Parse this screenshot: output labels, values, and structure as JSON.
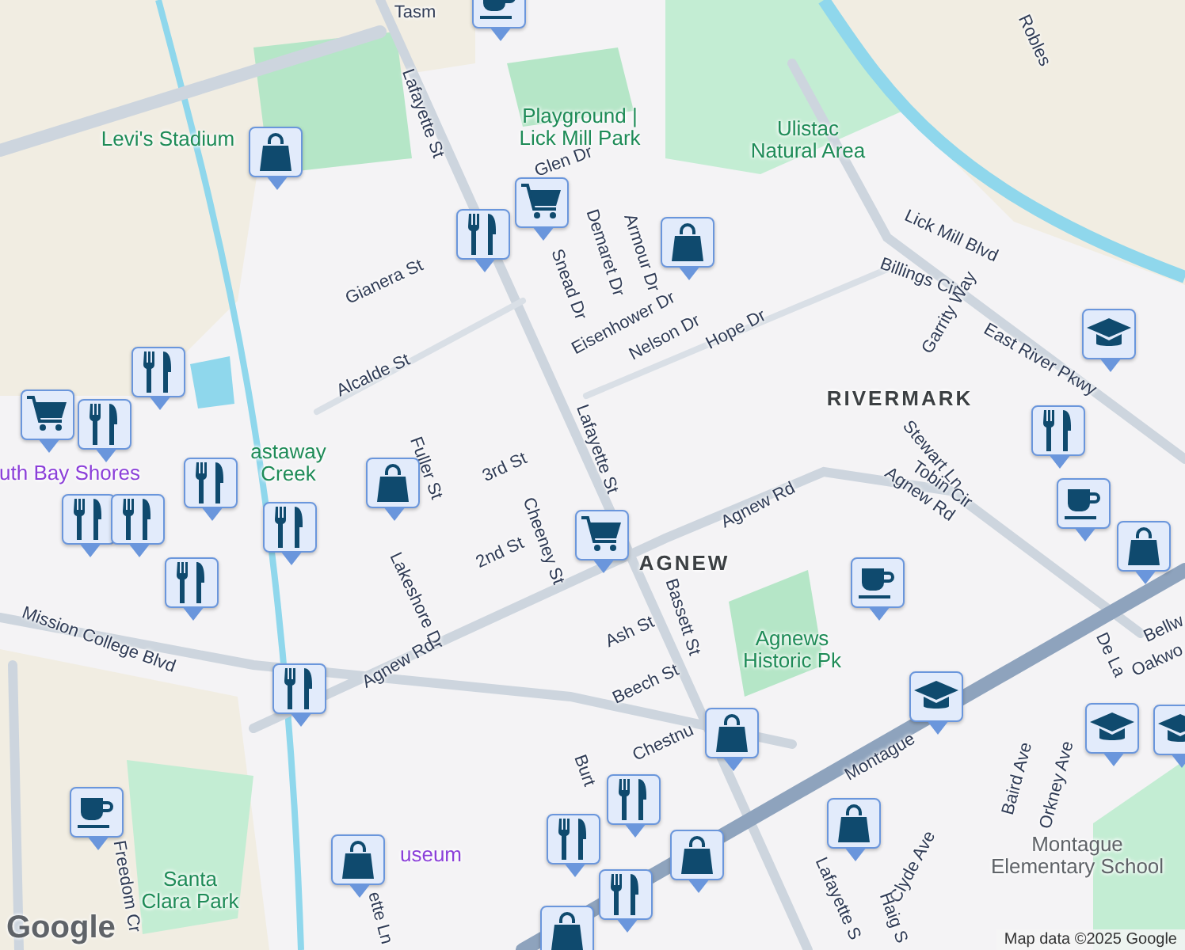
{
  "map": {
    "labels": [
      {
        "text": "Tasm",
        "kind": "street"
      },
      {
        "text": "Lafayette St",
        "kind": "street"
      },
      {
        "text": "Levi's Stadium",
        "kind": "park"
      },
      {
        "text": "Playground |\nLick Mill Park",
        "kind": "park"
      },
      {
        "text": "Ulistac\nNatural Area",
        "kind": "park"
      },
      {
        "text": "Robles",
        "kind": "street"
      },
      {
        "text": "Glen Dr",
        "kind": "street"
      },
      {
        "text": "Snead Dr",
        "kind": "street"
      },
      {
        "text": "Demaret Dr",
        "kind": "street"
      },
      {
        "text": "Armour Dr",
        "kind": "street"
      },
      {
        "text": "Eisenhower Dr",
        "kind": "street"
      },
      {
        "text": "Nelson Dr",
        "kind": "street"
      },
      {
        "text": "Hope Dr",
        "kind": "street"
      },
      {
        "text": "Lick Mill Blvd",
        "kind": "street"
      },
      {
        "text": "Billings Cir",
        "kind": "street"
      },
      {
        "text": "Garrity Way",
        "kind": "street"
      },
      {
        "text": "East River Pkwy",
        "kind": "street"
      },
      {
        "text": "RIVERMARK",
        "kind": "district"
      },
      {
        "text": "Gianera St",
        "kind": "street"
      },
      {
        "text": "Alcalde St",
        "kind": "street"
      },
      {
        "text": "uth Bay Shores",
        "kind": "place"
      },
      {
        "text": "astaway\nCreek",
        "kind": "park"
      },
      {
        "text": "Fuller St",
        "kind": "street"
      },
      {
        "text": "3rd St",
        "kind": "street"
      },
      {
        "text": "Lafayette St",
        "kind": "street"
      },
      {
        "text": "Stewart Ln",
        "kind": "street"
      },
      {
        "text": "Tobin Cir",
        "kind": "street"
      },
      {
        "text": "Agnew Rd",
        "kind": "street"
      },
      {
        "text": "Agnew Rd",
        "kind": "street"
      },
      {
        "text": "AGNEW",
        "kind": "district"
      },
      {
        "text": "2nd St",
        "kind": "street"
      },
      {
        "text": "Cheeney St",
        "kind": "street"
      },
      {
        "text": "Lakeshore Dr",
        "kind": "street"
      },
      {
        "text": "Agnew Rd",
        "kind": "street"
      },
      {
        "text": "Mission College Blvd",
        "kind": "street"
      },
      {
        "text": "Ash St",
        "kind": "street"
      },
      {
        "text": "Bassett St",
        "kind": "street"
      },
      {
        "text": "Agnews\nHistoric Pk",
        "kind": "park"
      },
      {
        "text": "Beech St",
        "kind": "street"
      },
      {
        "text": "Chestnu",
        "kind": "street"
      },
      {
        "text": "Montague",
        "kind": "street"
      },
      {
        "text": "Bellw",
        "kind": "street"
      },
      {
        "text": "Oakwo",
        "kind": "street"
      },
      {
        "text": "De La",
        "kind": "street"
      },
      {
        "text": "Baird Ave",
        "kind": "street"
      },
      {
        "text": "Orkney Ave",
        "kind": "street"
      },
      {
        "text": "Burt",
        "kind": "street"
      },
      {
        "text": "useum",
        "kind": "place"
      },
      {
        "text": "Montague\nElementary School",
        "kind": "school"
      },
      {
        "text": "Santa\nClara Park",
        "kind": "park"
      },
      {
        "text": "Freedom Cr",
        "kind": "street"
      },
      {
        "text": "Clyde Ave",
        "kind": "street"
      },
      {
        "text": "Lafayette S",
        "kind": "street"
      },
      {
        "text": "Haig S",
        "kind": "street"
      },
      {
        "text": "ette Ln",
        "kind": "street"
      }
    ],
    "pins": [
      {
        "kind": "cafe"
      },
      {
        "kind": "shopping"
      },
      {
        "kind": "grocery"
      },
      {
        "kind": "restaurant"
      },
      {
        "kind": "shopping"
      },
      {
        "kind": "school"
      },
      {
        "kind": "restaurant"
      },
      {
        "kind": "grocery"
      },
      {
        "kind": "restaurant"
      },
      {
        "kind": "restaurant"
      },
      {
        "kind": "restaurant"
      },
      {
        "kind": "restaurant"
      },
      {
        "kind": "restaurant"
      },
      {
        "kind": "restaurant"
      },
      {
        "kind": "shopping"
      },
      {
        "kind": "grocery"
      },
      {
        "kind": "cafe"
      },
      {
        "kind": "restaurant"
      },
      {
        "kind": "cafe"
      },
      {
        "kind": "shopping"
      },
      {
        "kind": "restaurant"
      },
      {
        "kind": "shopping"
      },
      {
        "kind": "school"
      },
      {
        "kind": "school"
      },
      {
        "kind": "school"
      },
      {
        "kind": "cafe"
      },
      {
        "kind": "shopping"
      },
      {
        "kind": "restaurant"
      },
      {
        "kind": "restaurant"
      },
      {
        "kind": "restaurant"
      },
      {
        "kind": "shopping"
      },
      {
        "kind": "shopping"
      },
      {
        "kind": "shopping"
      }
    ]
  },
  "logo": "Google",
  "attribution": "Map data ©2025 Google"
}
